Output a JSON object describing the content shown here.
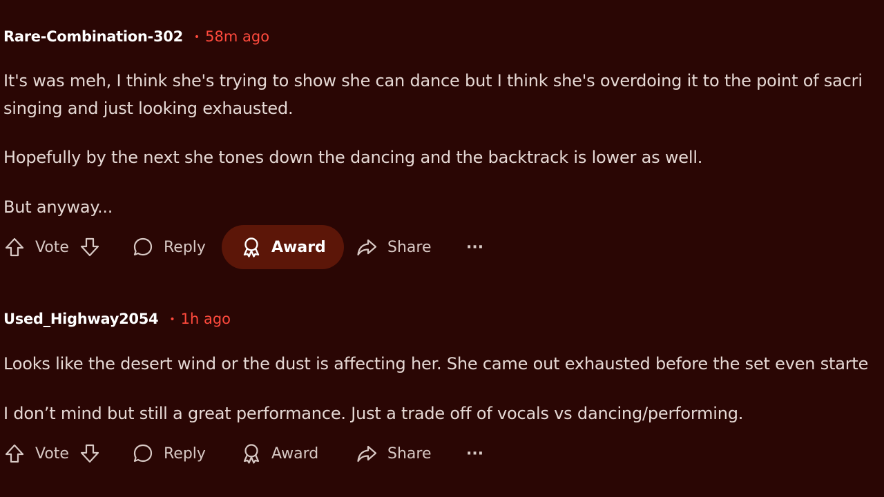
{
  "comments": [
    {
      "author": "Rare-Combination-302",
      "time": "58m ago",
      "paragraphs": [
        "It's was meh, I think she's trying to show she can dance but I think she's overdoing it to the point of sacri",
        "singing and just looking exhausted.",
        "Hopefully by the next she tones down the dancing and the backtrack is lower as well.",
        "But anyway..."
      ],
      "actions": {
        "vote": "Vote",
        "reply": "Reply",
        "award": "Award",
        "share": "Share",
        "more": "···"
      }
    },
    {
      "author": "Used_Highway2054",
      "time": "1h ago",
      "paragraphs": [
        "Looks like the desert wind or the dust is affecting her. She came out exhausted before the set even starte",
        "I don’t mind but still a great performance. Just a trade off of vocals vs dancing/performing."
      ],
      "actions": {
        "vote": "Vote",
        "reply": "Reply",
        "award": "Award",
        "share": "Share",
        "more": "···"
      }
    }
  ],
  "colors": {
    "background": "#2a0604",
    "timestamp": "#ff4a3d",
    "award_highlight": "#5c1608"
  }
}
